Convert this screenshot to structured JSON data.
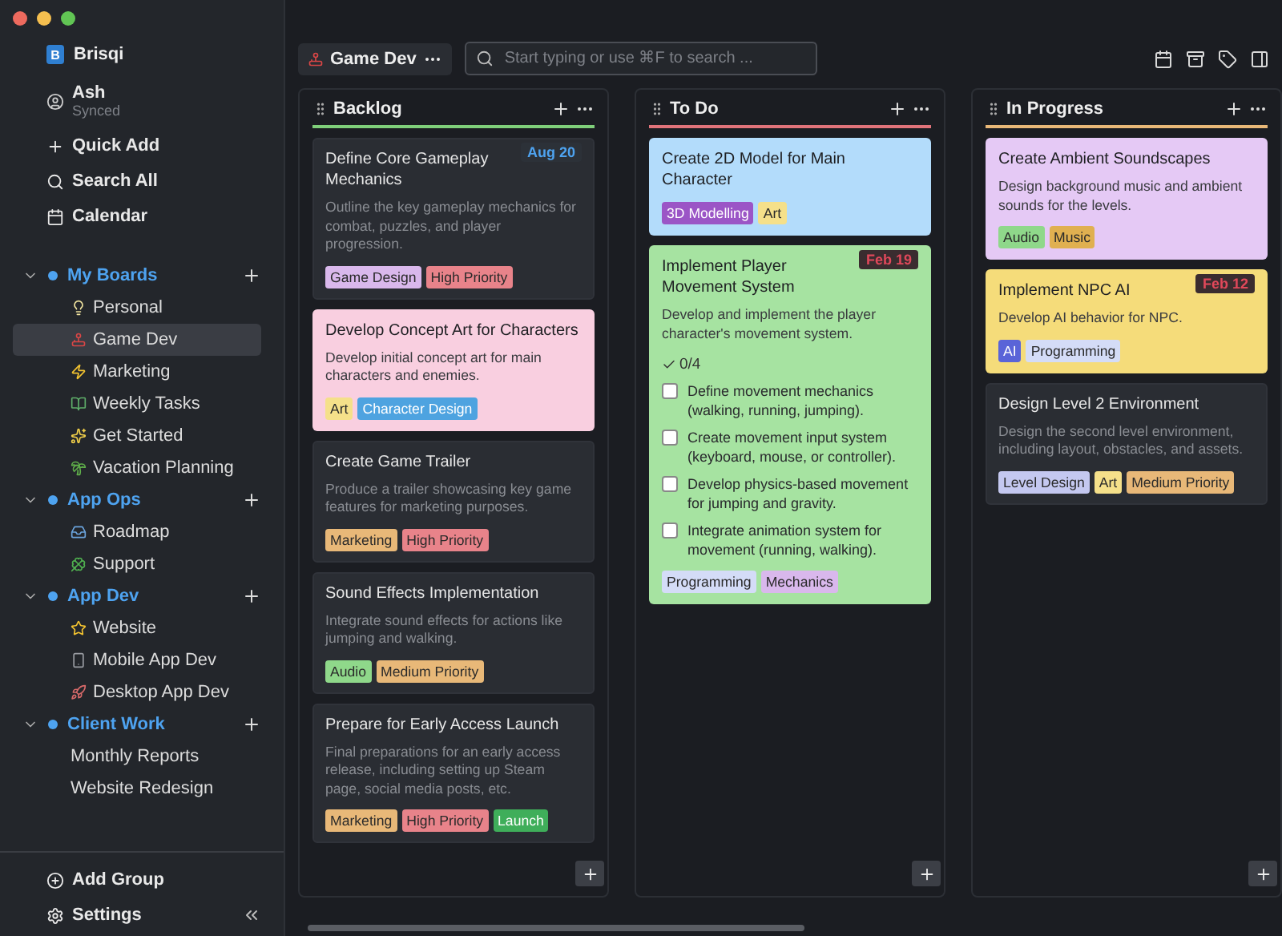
{
  "app": {
    "logo": "B",
    "name": "Brisqi"
  },
  "user": {
    "name": "Ash",
    "status": "Synced"
  },
  "nav": [
    {
      "kind": "add",
      "label": "Quick Add"
    },
    {
      "kind": "search",
      "label": "Search All"
    },
    {
      "kind": "calendar",
      "label": "Calendar"
    }
  ],
  "groups": [
    {
      "name": "My Boards",
      "expanded": true,
      "items": [
        {
          "kind": "bulb",
          "label": "Personal",
          "selected": false
        },
        {
          "kind": "joystick",
          "label": "Game Dev",
          "selected": true
        },
        {
          "kind": "bolt",
          "label": "Marketing",
          "selected": false
        },
        {
          "kind": "books",
          "label": "Weekly Tasks",
          "selected": false
        },
        {
          "kind": "sparkles",
          "label": "Get Started",
          "selected": false
        },
        {
          "kind": "palm",
          "label": "Vacation Planning",
          "selected": false
        }
      ]
    },
    {
      "name": "App Ops",
      "expanded": true,
      "items": [
        {
          "kind": "inbox",
          "label": "Roadmap",
          "selected": false
        },
        {
          "kind": "clover",
          "label": "Support",
          "selected": false
        }
      ]
    },
    {
      "name": "App Dev",
      "expanded": true,
      "items": [
        {
          "kind": "star",
          "label": "Website",
          "selected": false
        },
        {
          "kind": "phone",
          "label": "Mobile App Dev",
          "selected": false
        },
        {
          "kind": "rocket",
          "label": "Desktop App Dev",
          "selected": false
        }
      ]
    },
    {
      "name": "Client Work",
      "expanded": true,
      "items": [
        {
          "kind": "plain",
          "label": "Monthly Reports",
          "selected": false
        },
        {
          "kind": "plain",
          "label": "Website Redesign",
          "selected": false
        }
      ]
    }
  ],
  "footer": {
    "add_group": "Add Group",
    "settings": "Settings"
  },
  "board": {
    "kind": "joystick",
    "title": "Game Dev"
  },
  "search": {
    "placeholder": "Start typing or use ⌘F to search ..."
  },
  "columns": [
    {
      "title": "Backlog",
      "color": "#7fcf7a",
      "cards": [
        {
          "title": "Define Core Gameplay Mechanics",
          "color": "#2a2d33",
          "due": {
            "text": "Aug 20",
            "overdue": false
          },
          "description": "Outline the key gameplay mechanics for combat, puzzles, and player progression.",
          "tags": [
            {
              "label": "Game Design",
              "color": "#d9b8ec"
            },
            {
              "label": "High Priority",
              "color": "#e8838a"
            }
          ]
        },
        {
          "title": "Develop Concept Art for Characters",
          "color": "#f9cfe0",
          "description": "Develop initial concept art for main characters and enemies.",
          "tags": [
            {
              "label": "Art",
              "color": "#f5e08a"
            },
            {
              "label": "Character Design",
              "color": "#4ea3e0"
            }
          ]
        },
        {
          "title": "Create Game Trailer",
          "color": "#2a2d33",
          "description": "Produce a trailer showcasing key game features for marketing purposes.",
          "tags": [
            {
              "label": "Marketing",
              "color": "#e8b878"
            },
            {
              "label": "High Priority",
              "color": "#e8838a"
            }
          ]
        },
        {
          "title": "Sound Effects Implementation",
          "color": "#2a2d33",
          "description": "Integrate sound effects for actions like jumping and walking.",
          "tags": [
            {
              "label": "Audio",
              "color": "#8fd88a"
            },
            {
              "label": "Medium Priority",
              "color": "#e8b878"
            }
          ]
        },
        {
          "title": "Prepare for Early Access Launch",
          "color": "#2a2d33",
          "description": "Final preparations for an early access release, including setting up Steam page, social media posts, etc.",
          "tags": [
            {
              "label": "Marketing",
              "color": "#e8b878"
            },
            {
              "label": "High Priority",
              "color": "#e8838a"
            },
            {
              "label": "Launch",
              "color": "#3fae5a"
            }
          ]
        }
      ]
    },
    {
      "title": "To Do",
      "color": "#e0737a",
      "cards": [
        {
          "title": "Create 2D Model for Main Character",
          "color": "#b3dcfb",
          "tags": [
            {
              "label": "3D Modelling",
              "color": "#9b55c6"
            },
            {
              "label": "Art",
              "color": "#f5e08a"
            }
          ]
        },
        {
          "title": "Implement Player Movement System",
          "color": "#a6e3a1",
          "due": {
            "text": "Feb 19",
            "overdue": true
          },
          "description": "Develop and implement the player character's movement system.",
          "progress": "0/4",
          "checklist": [
            {
              "text": "Define movement mechanics (walking, running, jumping).",
              "checked": false
            },
            {
              "text": "Create movement input system (keyboard, mouse, or controller).",
              "checked": false
            },
            {
              "text": "Develop physics-based movement for jumping and gravity.",
              "checked": false
            },
            {
              "text": "Integrate animation system for movement (running, walking).",
              "checked": false
            }
          ],
          "tags": [
            {
              "label": "Programming",
              "color": "#d4dcf7"
            },
            {
              "label": "Mechanics",
              "color": "#d9b8ec"
            }
          ]
        }
      ]
    },
    {
      "title": "In Progress",
      "color": "#e8b878",
      "cards": [
        {
          "title": "Create Ambient Soundscapes",
          "color": "#e5c9f5",
          "description": "Design background music and ambient sounds for the levels.",
          "tags": [
            {
              "label": "Audio",
              "color": "#8fd88a"
            },
            {
              "label": "Music",
              "color": "#e0b050"
            }
          ]
        },
        {
          "title": "Implement NPC AI",
          "color": "#f5dc7a",
          "due": {
            "text": "Feb 12",
            "overdue": true
          },
          "description": "Develop AI behavior for NPC.",
          "tags": [
            {
              "label": "AI",
              "color": "#5a64d8"
            },
            {
              "label": "Programming",
              "color": "#d4dcf7"
            }
          ]
        },
        {
          "title": "Design Level 2 Environment",
          "color": "#2a2d33",
          "description": "Design the second level environment, including layout, obstacles, and assets.",
          "tags": [
            {
              "label": "Level Design",
              "color": "#c4c8f0"
            },
            {
              "label": "Art",
              "color": "#f5e08a"
            },
            {
              "label": "Medium Priority",
              "color": "#e8b878"
            }
          ]
        }
      ]
    }
  ]
}
